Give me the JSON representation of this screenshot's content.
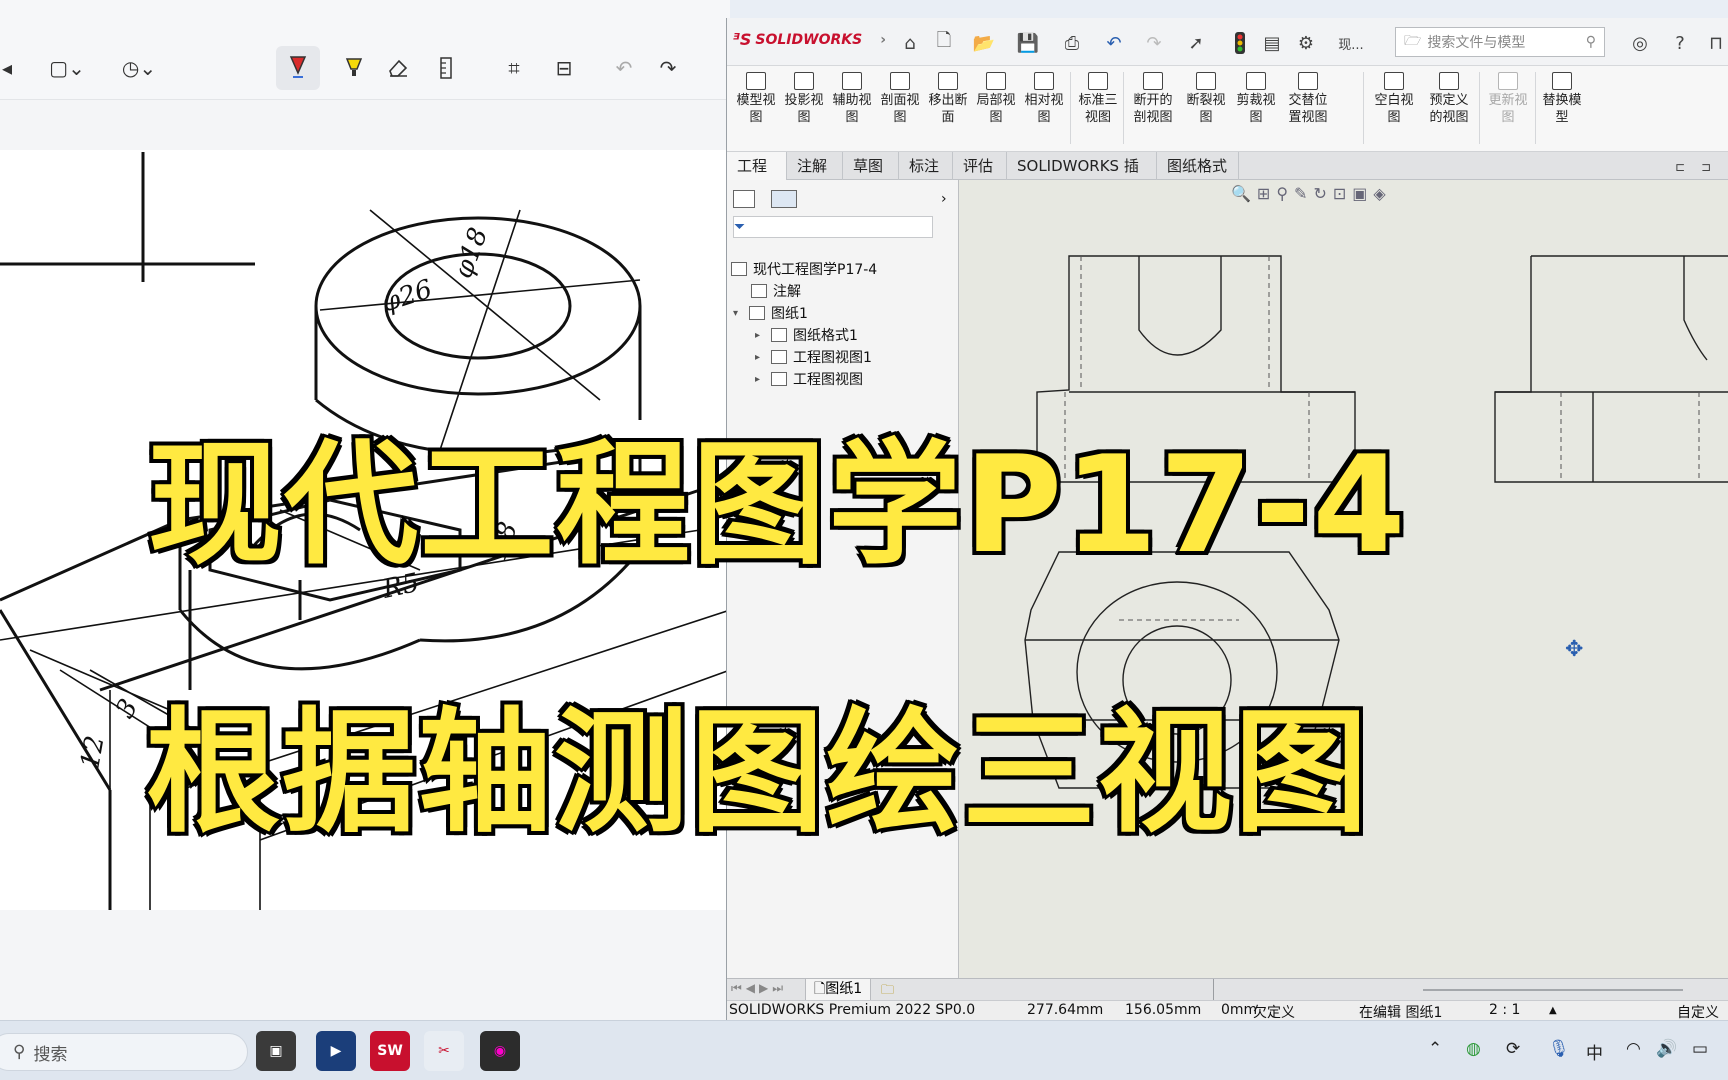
{
  "headline": {
    "line1": "现代工程图学P17-4",
    "line2": "根据轴测图绘三视图"
  },
  "viewer": {
    "toolbar": [
      {
        "icon": "crop-rect-icon"
      },
      {
        "icon": "history-clock-icon"
      },
      {
        "icon": "pen-icon"
      },
      {
        "icon": "highlighter-icon"
      },
      {
        "icon": "eraser-icon"
      },
      {
        "icon": "ruler-icon"
      },
      {
        "icon": "crop-icon"
      },
      {
        "icon": "text-scan-icon"
      },
      {
        "icon": "undo-icon"
      },
      {
        "icon": "redo-icon"
      }
    ],
    "dims": [
      "φ26",
      "φ18",
      "R5",
      "R8",
      "12",
      "3"
    ]
  },
  "sw": {
    "brand": "SOLIDWORKS",
    "search_placeholder": "搜索文件与模型",
    "title_extra": "现...",
    "ribbon": [
      {
        "label": "模型视\n图",
        "disabled": false
      },
      {
        "label": "投影视\n图",
        "disabled": false
      },
      {
        "label": "辅助视\n图",
        "disabled": false
      },
      {
        "label": "剖面视\n图",
        "disabled": false
      },
      {
        "label": "移出断\n面",
        "disabled": false
      },
      {
        "label": "局部视\n图",
        "disabled": false
      },
      {
        "label": "相对视\n图",
        "disabled": false
      },
      {
        "label": "标准三\n视图",
        "disabled": false
      },
      {
        "label": "断开的\n剖视图",
        "disabled": false
      },
      {
        "label": "断裂视\n图",
        "disabled": false
      },
      {
        "label": "剪裁视\n图",
        "disabled": false
      },
      {
        "label": "交替位\n置视图",
        "disabled": false
      },
      {
        "label": "空白视\n图",
        "disabled": false
      },
      {
        "label": "预定义\n的视图",
        "disabled": false
      },
      {
        "label": "更新视\n图",
        "disabled": true
      },
      {
        "label": "替换模\n型",
        "disabled": false
      }
    ],
    "tabs": [
      "工程图",
      "注解",
      "草图",
      "标注",
      "评估",
      "SOLIDWORKS 插件",
      "图纸格式"
    ],
    "tree": {
      "root": "现代工程图学P17-4",
      "annotations": "注解",
      "sheet": "图纸1",
      "sheet_format": "图纸格式1",
      "view1": "工程图视图1",
      "view2": "工程图视图"
    },
    "sheet_tab": "图纸1",
    "status": {
      "product": "SOLIDWORKS Premium 2022 SP0.0",
      "x": "277.64mm",
      "y": "156.05mm",
      "z": "0mm",
      "defined": "欠定义",
      "editing": "在编辑 图纸1",
      "scale": "2 : 1",
      "custom": "自定义"
    }
  },
  "taskbar": {
    "search_label": "搜索",
    "ime": "中",
    "apps": [
      {
        "icon": "task-view-icon",
        "label": ""
      },
      {
        "icon": "screen-recorder-icon",
        "label": ""
      },
      {
        "icon": "solidworks-app-icon",
        "label": "SW"
      },
      {
        "icon": "snipping-tool-icon",
        "label": ""
      },
      {
        "icon": "media-app-icon",
        "label": ""
      }
    ],
    "colors": {
      "sw_red": "#c8102e",
      "accent_yellow": "#ffe941"
    }
  }
}
